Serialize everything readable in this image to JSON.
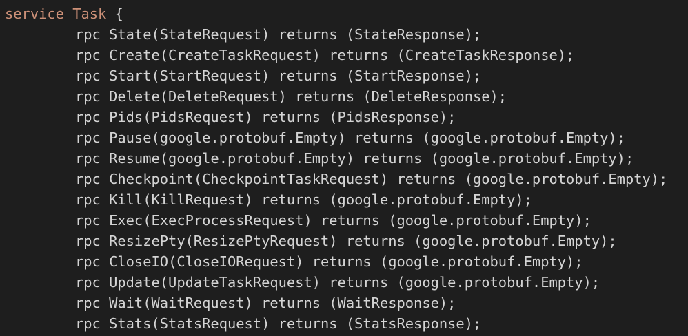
{
  "editor": {
    "header": {
      "keyword": "service",
      "name": "Task",
      "brace": "{"
    },
    "lines": [
      "rpc State(StateRequest) returns (StateResponse);",
      "rpc Create(CreateTaskRequest) returns (CreateTaskResponse);",
      "rpc Start(StartRequest) returns (StartResponse);",
      "rpc Delete(DeleteRequest) returns (DeleteResponse);",
      "rpc Pids(PidsRequest) returns (PidsResponse);",
      "rpc Pause(google.protobuf.Empty) returns (google.protobuf.Empty);",
      "rpc Resume(google.protobuf.Empty) returns (google.protobuf.Empty);",
      "rpc Checkpoint(CheckpointTaskRequest) returns (google.protobuf.Empty);",
      "rpc Kill(KillRequest) returns (google.protobuf.Empty);",
      "rpc Exec(ExecProcessRequest) returns (google.protobuf.Empty);",
      "rpc ResizePty(ResizePtyRequest) returns (google.protobuf.Empty);",
      "rpc CloseIO(CloseIORequest) returns (google.protobuf.Empty);",
      "rpc Update(UpdateTaskRequest) returns (google.protobuf.Empty);",
      "rpc Wait(WaitRequest) returns (WaitResponse);",
      "rpc Stats(StatsRequest) returns (StatsResponse);"
    ]
  }
}
